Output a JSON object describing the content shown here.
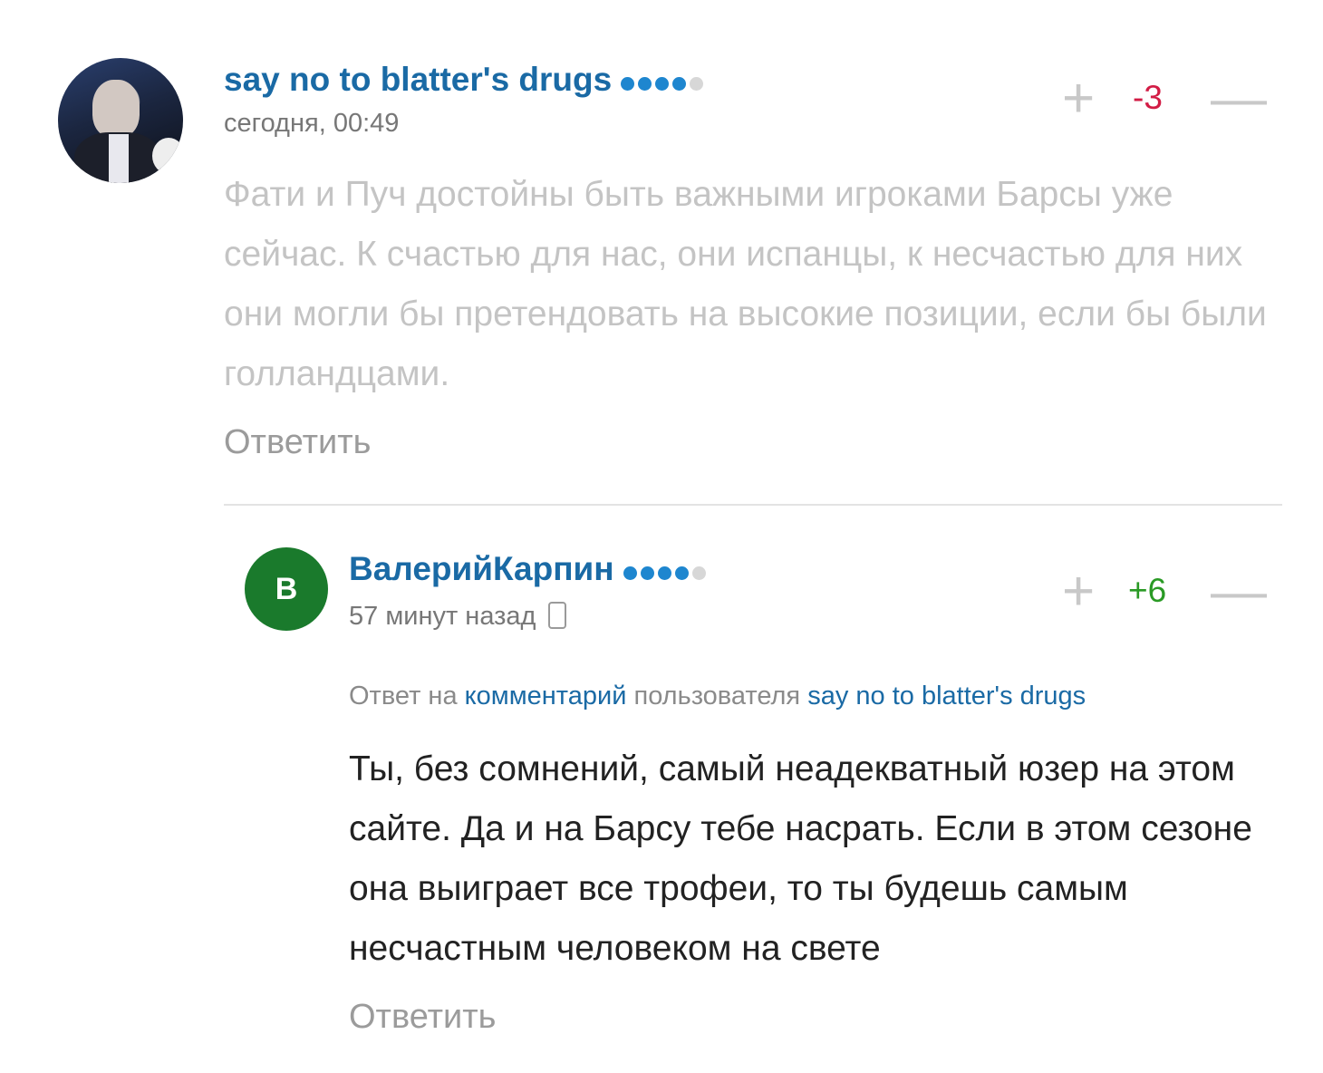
{
  "comments": [
    {
      "username": "say no to blatter's drugs",
      "rating_dots": 4,
      "rating_max": 5,
      "timestamp": "сегодня, 00:49",
      "score": "-3",
      "text": "Фати и Пуч достойны быть важными игроками Барсы уже сейчас. К счастью для нас, они испанцы, к несчастью для них они могли бы претендовать на высокие позиции, если бы были голландцами.",
      "reply_label": "Ответить",
      "avatar": "user-photo"
    },
    {
      "username": "ВалерийКарпин",
      "rating_dots": 4,
      "rating_max": 5,
      "avatar_letter": "В",
      "timestamp": "57 минут назад",
      "device_icon": "mobile-phone-icon",
      "score": "+6",
      "reply_to": {
        "prefix": "Ответ на",
        "link_comment": "комментарий",
        "middle": "пользователя",
        "link_user": "say no to blatter's drugs"
      },
      "text": "Ты, без сомнений, самый неадекватный юзер на этом сайте. Да и на Барсу тебе насрать. Если в этом сезоне она выиграет все трофеи, то ты будешь самым несчастным человеком на свете",
      "reply_label": "Ответить"
    }
  ],
  "vote": {
    "plus_symbol": "+",
    "minus_symbol": "—"
  },
  "colors": {
    "link": "#1a6aa5",
    "negative": "#d21c45",
    "positive": "#2a9a25",
    "dot": "#1e86cf",
    "avatar_bg": "#1a7a2c"
  }
}
